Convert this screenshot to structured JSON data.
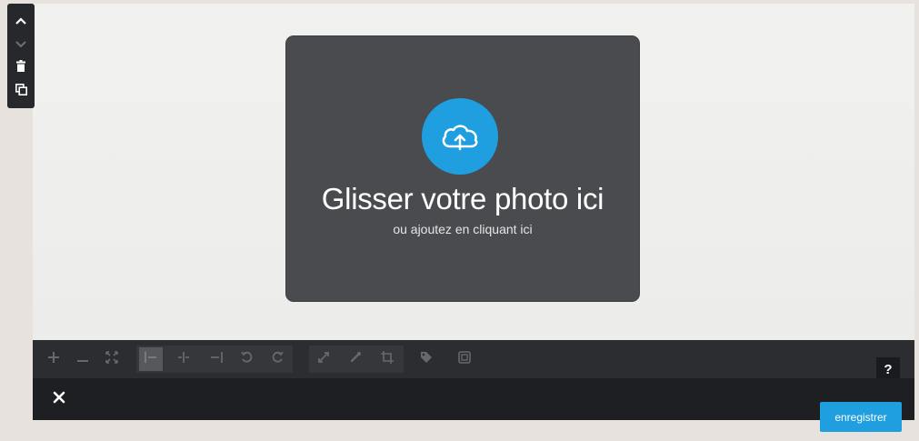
{
  "dropzone": {
    "title": "Glisser votre photo ici",
    "subtitle": "ou ajoutez en cliquant ici"
  },
  "side_toolbar": {
    "items": [
      {
        "icon": "chevron-up-icon"
      },
      {
        "icon": "chevron-down-icon"
      },
      {
        "icon": "trash-icon"
      },
      {
        "icon": "duplicate-icon"
      }
    ]
  },
  "toolbar": {
    "tools": [
      {
        "icon": "zoom-in-icon"
      },
      {
        "icon": "zoom-out-icon"
      },
      {
        "icon": "fit-icon"
      },
      {
        "icon": "align-left-icon"
      },
      {
        "icon": "align-center-icon"
      },
      {
        "icon": "align-right-icon"
      },
      {
        "icon": "rotate-left-icon"
      },
      {
        "icon": "rotate-right-icon"
      },
      {
        "icon": "resize-icon"
      },
      {
        "icon": "link-icon"
      },
      {
        "icon": "crop-icon"
      },
      {
        "icon": "tag-icon"
      },
      {
        "icon": "frame-icon"
      }
    ],
    "help_label": "?"
  },
  "footer": {
    "save_label": "enregistrer"
  },
  "colors": {
    "accent": "#1f9ee0",
    "dropzone_bg": "#4a4b4f",
    "toolbar_bg": "#2b2d31"
  }
}
